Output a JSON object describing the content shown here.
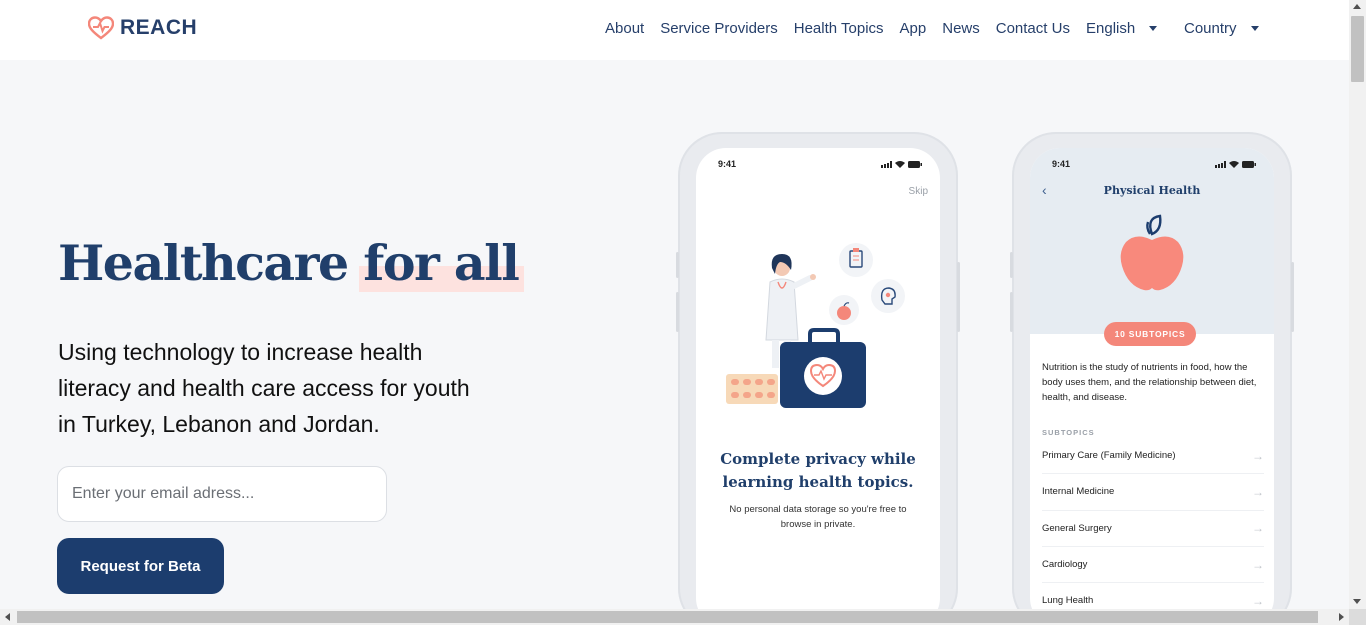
{
  "nav": {
    "brand": "REACH",
    "links": [
      "About",
      "Service Providers",
      "Health Topics",
      "App",
      "News",
      "Contact Us"
    ],
    "language": "English",
    "country": "Country"
  },
  "hero": {
    "title_main": "Healthcare",
    "title_highlight": "for all",
    "subtitle": "Using technology to increase health literacy and health care access for youth in Turkey, Lebanon and Jordan.",
    "email_placeholder": "Enter your email adress...",
    "cta_label": "Request for Beta"
  },
  "phone_left": {
    "time": "9:41",
    "skip": "Skip",
    "title": "Complete privacy while learning health topics.",
    "description": "No personal data storage so you're free to browse in private."
  },
  "phone_right": {
    "time": "9:41",
    "title": "Physical Health",
    "pill": "10 SUBTOPICS",
    "description": "Nutrition is the study of nutrients in food, how the body uses them, and the relationship between diet, health, and disease.",
    "subtopics_heading": "SUBTOPICS",
    "subtopics": [
      "Primary Care (Family Medicine)",
      "Internal Medicine",
      "General Surgery",
      "Cardiology",
      "Lung Health"
    ]
  },
  "colors": {
    "navy": "#203f6b",
    "button": "#1c3d6e",
    "accent_coral": "#f4877a",
    "highlight": "#fde2df"
  }
}
